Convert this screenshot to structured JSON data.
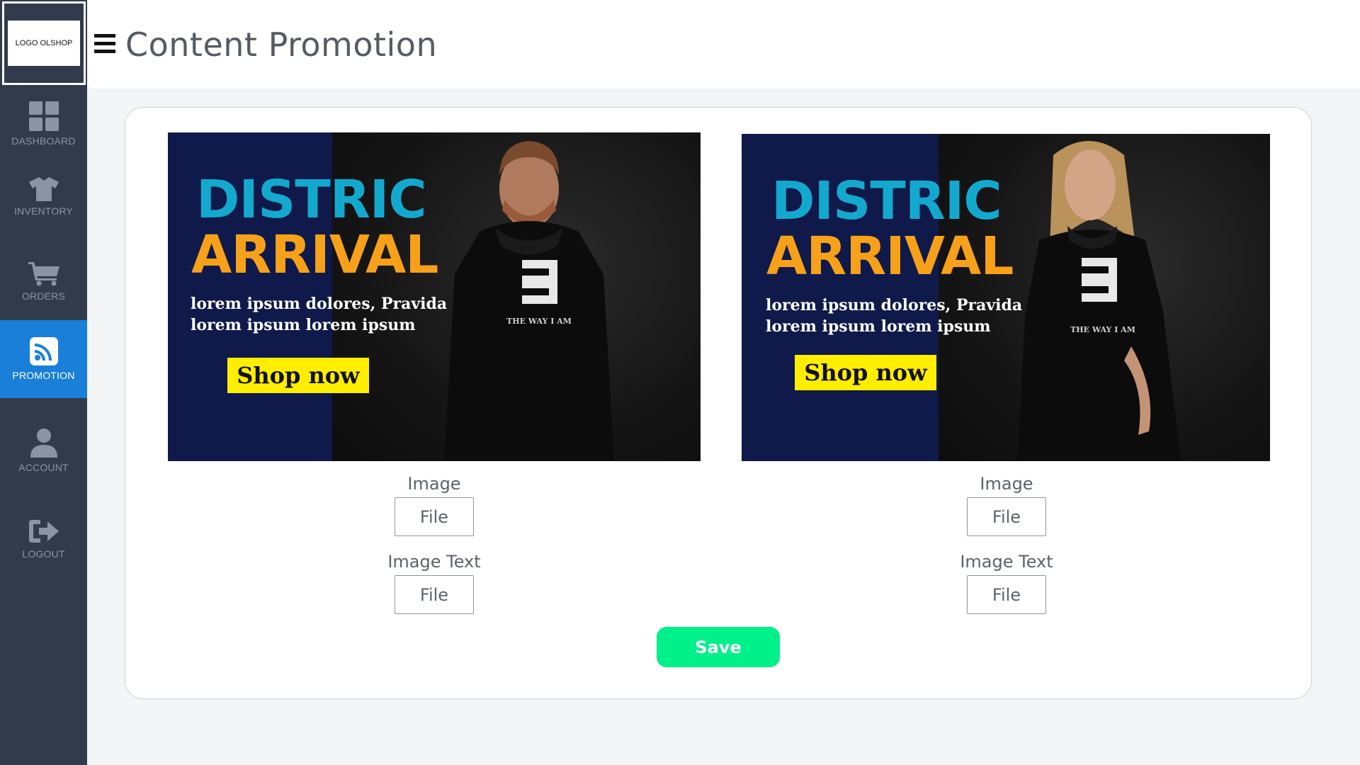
{
  "app": {
    "logo_text": "LOGO OLSHOP",
    "page_title": "Content Promotion"
  },
  "sidebar": {
    "items": [
      {
        "id": "dashboard",
        "label": "DASHBOARD",
        "icon": "grid-icon",
        "active": false
      },
      {
        "id": "inventory",
        "label": "INVENTORY",
        "icon": "tshirt-icon",
        "active": false
      },
      {
        "id": "orders",
        "label": "ORDERS",
        "icon": "cart-icon",
        "active": false
      },
      {
        "id": "promotion",
        "label": "PROMOTION",
        "icon": "rss-icon",
        "active": true
      },
      {
        "id": "account",
        "label": "ACCOUNT",
        "icon": "user-icon",
        "active": false
      },
      {
        "id": "logout",
        "label": "LOGOUT",
        "icon": "sign-out-icon",
        "active": false
      }
    ]
  },
  "promotions": [
    {
      "banner": {
        "title_line1": "DISTRIC",
        "title_line2": "ARRIVAL",
        "sub_line1": "lorem ipsum dolores, Pravida",
        "sub_line2": "lorem ipsum  lorem ipsum",
        "cta": "Shop now",
        "hoodie_text": "THE WAY I AM"
      },
      "image_label": "Image",
      "image_button": "File",
      "image_text_label": "Image Text",
      "image_text_button": "File"
    },
    {
      "banner": {
        "title_line1": "DISTRIC",
        "title_line2": "ARRIVAL",
        "sub_line1": "lorem ipsum dolores, Pravida",
        "sub_line2": "lorem ipsum lorem ipsum",
        "cta": "Shop now",
        "hoodie_text": "THE WAY I AM"
      },
      "image_label": "Image",
      "image_button": "File",
      "image_text_label": "Image Text",
      "image_text_button": "File"
    }
  ],
  "actions": {
    "save_label": "Save"
  },
  "colors": {
    "sidebar_bg": "#323b4c",
    "active_nav": "#1a7fd9",
    "save_button": "#00f08a",
    "banner_navy": "#0f1a4a",
    "title_cyan": "#13a9cf",
    "title_orange": "#f7a11a",
    "cta_yellow": "#ffee00"
  }
}
